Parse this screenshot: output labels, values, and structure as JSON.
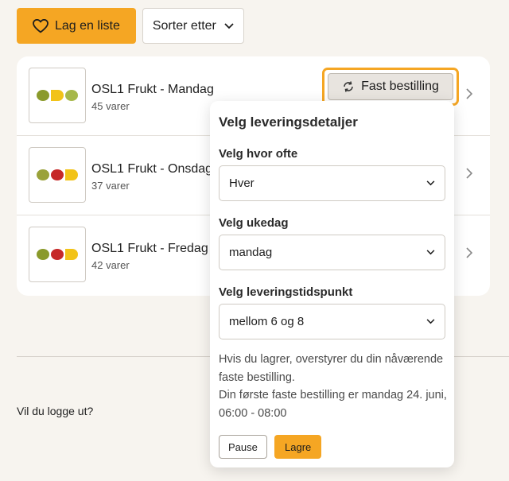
{
  "toolbar": {
    "create_list_label": "Lag en liste",
    "sort_label": "Sorter etter"
  },
  "lists": [
    {
      "name": "OSL1 Frukt - Mandag",
      "count": "45 varer"
    },
    {
      "name": "OSL1 Frukt - Onsdag",
      "count": "37 varer"
    },
    {
      "name": "OSL1 Frukt - Fredag",
      "count": "42 varer"
    }
  ],
  "fast_order": {
    "label": "Fast bestilling"
  },
  "popover": {
    "title": "Velg leveringsdetaljer",
    "frequency": {
      "label": "Velg hvor ofte",
      "value": "Hver"
    },
    "weekday": {
      "label": "Velg ukedag",
      "value": "mandag"
    },
    "time": {
      "label": "Velg leveringstidspunkt",
      "value": "mellom 6 og 8"
    },
    "info_line1": "Hvis du lagrer, overstyrer du din nåværende faste bestilling.",
    "info_line2": "Din første faste bestilling er mandag 24. juni, 06:00 - 08:00",
    "pause_label": "Pause",
    "save_label": "Lagre"
  },
  "logout": {
    "text": "Vil du logge ut?"
  },
  "colors": {
    "accent": "#f5a623",
    "background": "#f7f4ef"
  }
}
